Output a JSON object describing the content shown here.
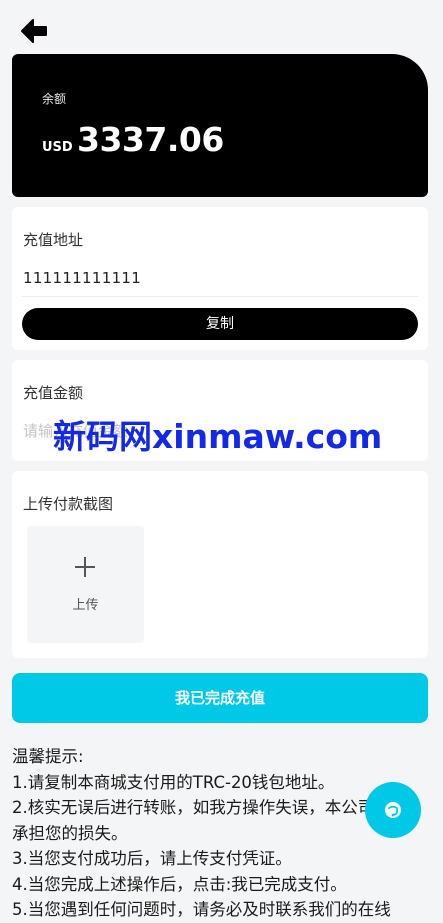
{
  "balance": {
    "label": "余额",
    "currency": "USD",
    "amount": "3337.06"
  },
  "address": {
    "title": "充值地址",
    "value": "111111111111",
    "copy_label": "复制"
  },
  "amount": {
    "title": "充值金额",
    "placeholder": "请输入充值金额"
  },
  "upload": {
    "title": "上传付款截图",
    "button_label": "上传"
  },
  "submit_label": "我已完成充值",
  "tips": {
    "heading": "温馨提示:",
    "lines": [
      "1.请复制本商城支付用的TRC-20钱包地址。",
      "2.核实无误后进行转账，如我方操作失误，本公司不",
      "承担您的损失。",
      "3.当您支付成功后，请上传支付凭证。",
      "4.当您完成上述操作后，点击:我已完成支付。",
      "5.当您遇到任何问题时，请务必及时联系我们的在线"
    ]
  },
  "watermark": "新码网xinmaw.com",
  "colors": {
    "accent": "#00c9e8",
    "card_dark": "#000000",
    "watermark": "#1428e8"
  },
  "icons": {
    "back": "arrow-left-icon",
    "plus": "plus-icon",
    "chat": "chat-support-icon"
  }
}
